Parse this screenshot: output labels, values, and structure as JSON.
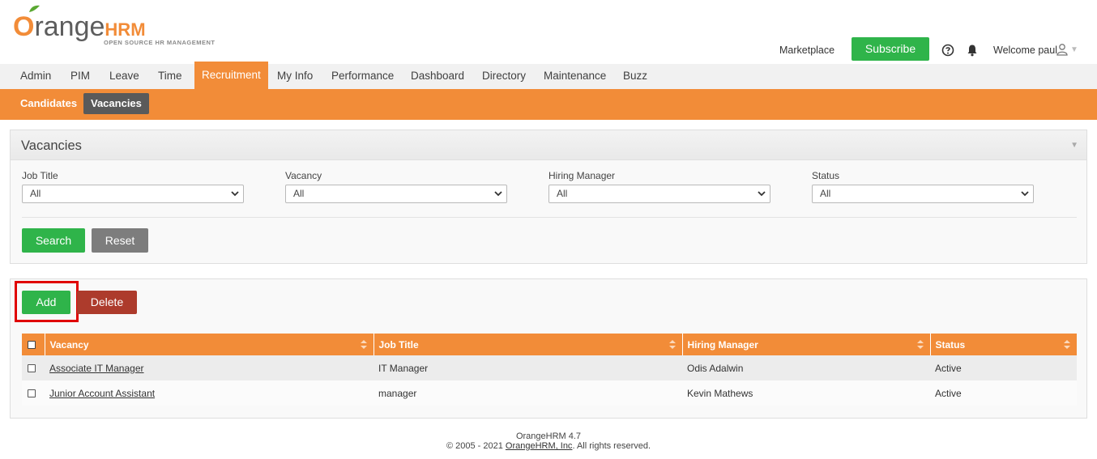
{
  "brand": {
    "logo_word_main": "range",
    "logo_word_o": "O",
    "logo_word_hrm": "HRM",
    "logo_tagline": "OPEN SOURCE HR MANAGEMENT",
    "accent_color": "#f28c38"
  },
  "topbar": {
    "marketplace": "Marketplace",
    "subscribe": "Subscribe",
    "welcome": "Welcome paul"
  },
  "mainnav": {
    "tabs": [
      {
        "label": "Admin"
      },
      {
        "label": "PIM"
      },
      {
        "label": "Leave"
      },
      {
        "label": "Time"
      },
      {
        "label": "Recruitment",
        "active": true
      },
      {
        "label": "My Info"
      },
      {
        "label": "Performance"
      },
      {
        "label": "Dashboard"
      },
      {
        "label": "Directory"
      },
      {
        "label": "Maintenance"
      },
      {
        "label": "Buzz"
      }
    ]
  },
  "subnav": {
    "items": [
      {
        "label": "Candidates"
      },
      {
        "label": "Vacancies",
        "active": true
      }
    ]
  },
  "search": {
    "title": "Vacancies",
    "fields": [
      {
        "label": "Job Title",
        "value": "All"
      },
      {
        "label": "Vacancy",
        "value": "All"
      },
      {
        "label": "Hiring Manager",
        "value": "All"
      },
      {
        "label": "Status",
        "value": "All"
      }
    ],
    "search_label": "Search",
    "reset_label": "Reset"
  },
  "list": {
    "add_label": "Add",
    "delete_label": "Delete",
    "columns": [
      "Vacancy",
      "Job Title",
      "Hiring Manager",
      "Status"
    ],
    "rows": [
      {
        "vacancy": "Associate IT Manager",
        "job_title": "IT Manager",
        "hiring_manager": "Odis Adalwin",
        "status": "Active"
      },
      {
        "vacancy": "Junior Account Assistant",
        "job_title": "manager",
        "hiring_manager": "Kevin Mathews",
        "status": "Active"
      }
    ]
  },
  "footer": {
    "version": "OrangeHRM 4.7",
    "copyright_prefix": "© 2005 - 2021 ",
    "company_link": "OrangeHRM, Inc",
    "copyright_suffix": ". All rights reserved."
  }
}
